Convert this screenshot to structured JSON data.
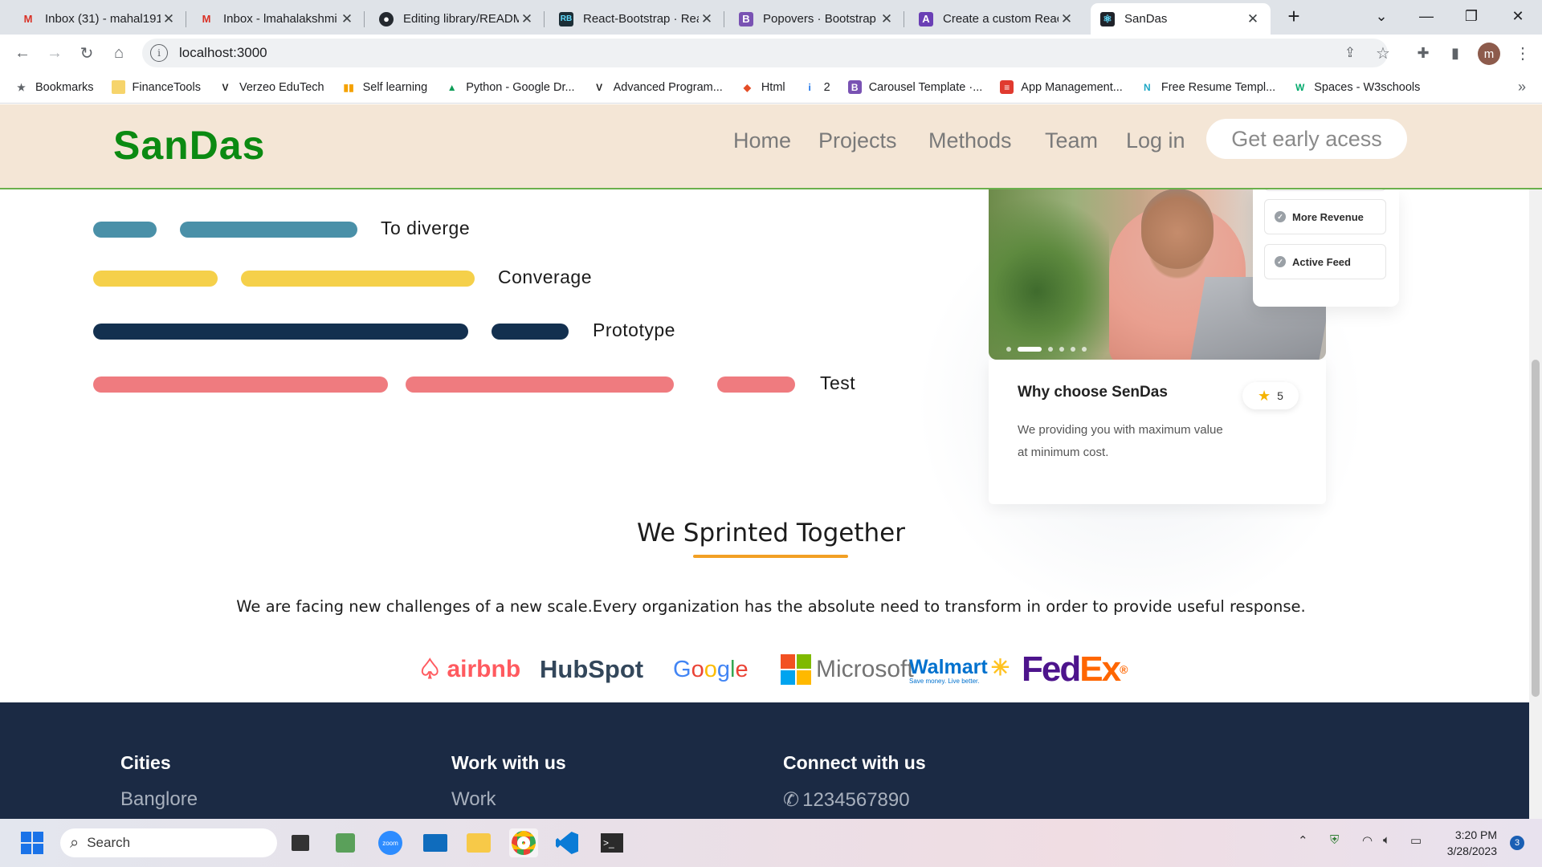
{
  "browser": {
    "tabs": [
      {
        "label": "Inbox (31) - mahal191",
        "icon": "gmail-icon",
        "active": false
      },
      {
        "label": "Inbox - lmahalakshmi",
        "icon": "gmail-icon",
        "active": false
      },
      {
        "label": "Editing library/READM",
        "icon": "github-icon",
        "active": false
      },
      {
        "label": "React-Bootstrap · Rea",
        "icon": "react-bootstrap-icon",
        "active": false
      },
      {
        "label": "Popovers · Bootstrap",
        "icon": "bootstrap-icon",
        "active": false
      },
      {
        "label": "Create a custom Reac",
        "icon": "app-icon",
        "active": false
      },
      {
        "label": "SanDas",
        "icon": "react-icon",
        "active": true
      }
    ],
    "new_tab": "+",
    "url": "localhost:3000",
    "profile_initial": "m",
    "bookmarks": [
      {
        "label": "Bookmarks",
        "icon": "star-icon"
      },
      {
        "label": "FinanceTools",
        "icon": "folder-icon"
      },
      {
        "label": "Verzeo EduTech",
        "icon": "verzeo-icon"
      },
      {
        "label": "Self learning",
        "icon": "chart-icon"
      },
      {
        "label": "Python - Google Dr...",
        "icon": "google-drive-icon"
      },
      {
        "label": "Advanced Program...",
        "icon": "verzeo-icon"
      },
      {
        "label": "Html",
        "icon": "html-icon"
      },
      {
        "label": "2",
        "icon": "info-icon"
      },
      {
        "label": "Carousel Template ·...",
        "icon": "bootstrap-icon"
      },
      {
        "label": "App Management...",
        "icon": "app-management-icon"
      },
      {
        "label": "Free Resume Templ...",
        "icon": "n-icon"
      },
      {
        "label": "Spaces - W3schools",
        "icon": "w3schools-icon"
      }
    ],
    "bookmarks_more": "»"
  },
  "site": {
    "brand": "SanDas",
    "nav": [
      "Home",
      "Projects",
      "Methods",
      "Team",
      "Log in"
    ],
    "cta": "Get early acess",
    "process": [
      {
        "label": "To diverge",
        "color": "#4a90a8"
      },
      {
        "label": "Converage",
        "color": "#f5d04a"
      },
      {
        "label": "Prototype",
        "color": "#13304f"
      },
      {
        "label": "Test",
        "color": "#ef7b7f"
      }
    ],
    "card": {
      "options": [
        "More Revenue",
        "Active Feed"
      ],
      "title": "Why choose SenDas",
      "rating": "5",
      "text": "We providing you with maximum value at minimum cost."
    },
    "section": {
      "title": "We Sprinted Together",
      "text": "We are facing new challenges of a new scale.Every organization has the absolute need to transform in order to provide useful response.",
      "accent": "#f2a024"
    },
    "logos": {
      "airbnb": "airbnb",
      "hubspot": "HubSpot",
      "google": "Google",
      "microsoft": "Microsoft",
      "walmart": "Walmart",
      "walmart_tagline": "Save money. Live better.",
      "fedex_fed": "Fed",
      "fedex_ex": "Ex"
    },
    "footer": {
      "cities_heading": "Cities",
      "city_1": "Banglore",
      "work_heading": "Work with us",
      "work_1": "Work",
      "connect_heading": "Connect with us",
      "phone": "1234567890"
    }
  },
  "taskbar": {
    "search": "Search",
    "time": "3:20 PM",
    "date": "3/28/2023",
    "notifications": "3"
  }
}
